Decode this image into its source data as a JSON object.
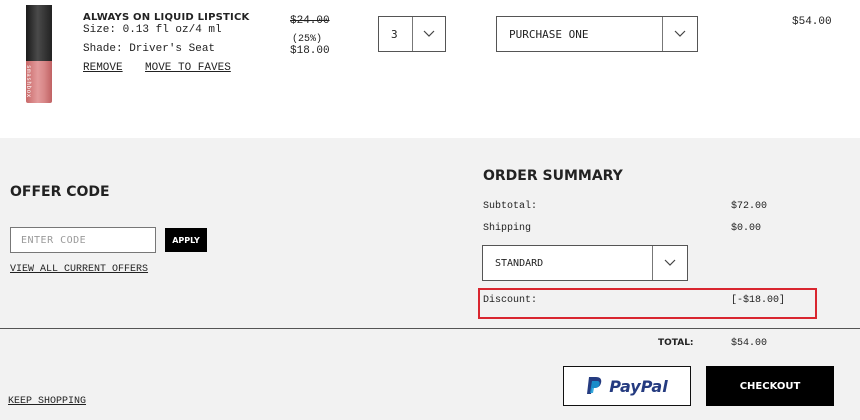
{
  "product": {
    "name": "ALWAYS ON LIQUID LIPSTICK",
    "size": "Size: 0.13 fl oz/4 ml",
    "shade": "Shade: Driver's Seat",
    "brand_on_tube": "smashbox",
    "remove_label": "REMOVE",
    "move_label": "MOVE TO FAVES",
    "original_price": "$24.00",
    "discount_percent": "(25%)",
    "sale_price": "$18.00",
    "quantity": "3",
    "purchase_option": "PURCHASE ONE",
    "line_total": "$54.00"
  },
  "offer": {
    "title": "OFFER CODE",
    "placeholder": "ENTER CODE",
    "apply_label": "APPLY",
    "view_offers_label": "VIEW ALL CURRENT OFFERS"
  },
  "summary": {
    "title": "ORDER SUMMARY",
    "subtotal_label": "Subtotal:",
    "subtotal_value": "$72.00",
    "shipping_label": "Shipping",
    "shipping_value": "$0.00",
    "shipping_method": "STANDARD",
    "discount_label": "Discount:",
    "discount_value": "[-$18.00]",
    "total_label": "TOTAL:",
    "total_value": "$54.00"
  },
  "footer": {
    "keep_shopping_label": "KEEP SHOPPING",
    "paypal_label": "PayPal",
    "checkout_label": "CHECKOUT"
  },
  "colors": {
    "highlight": "#d9262f",
    "paypal_dark": "#253b80",
    "paypal_light": "#179bd7"
  }
}
